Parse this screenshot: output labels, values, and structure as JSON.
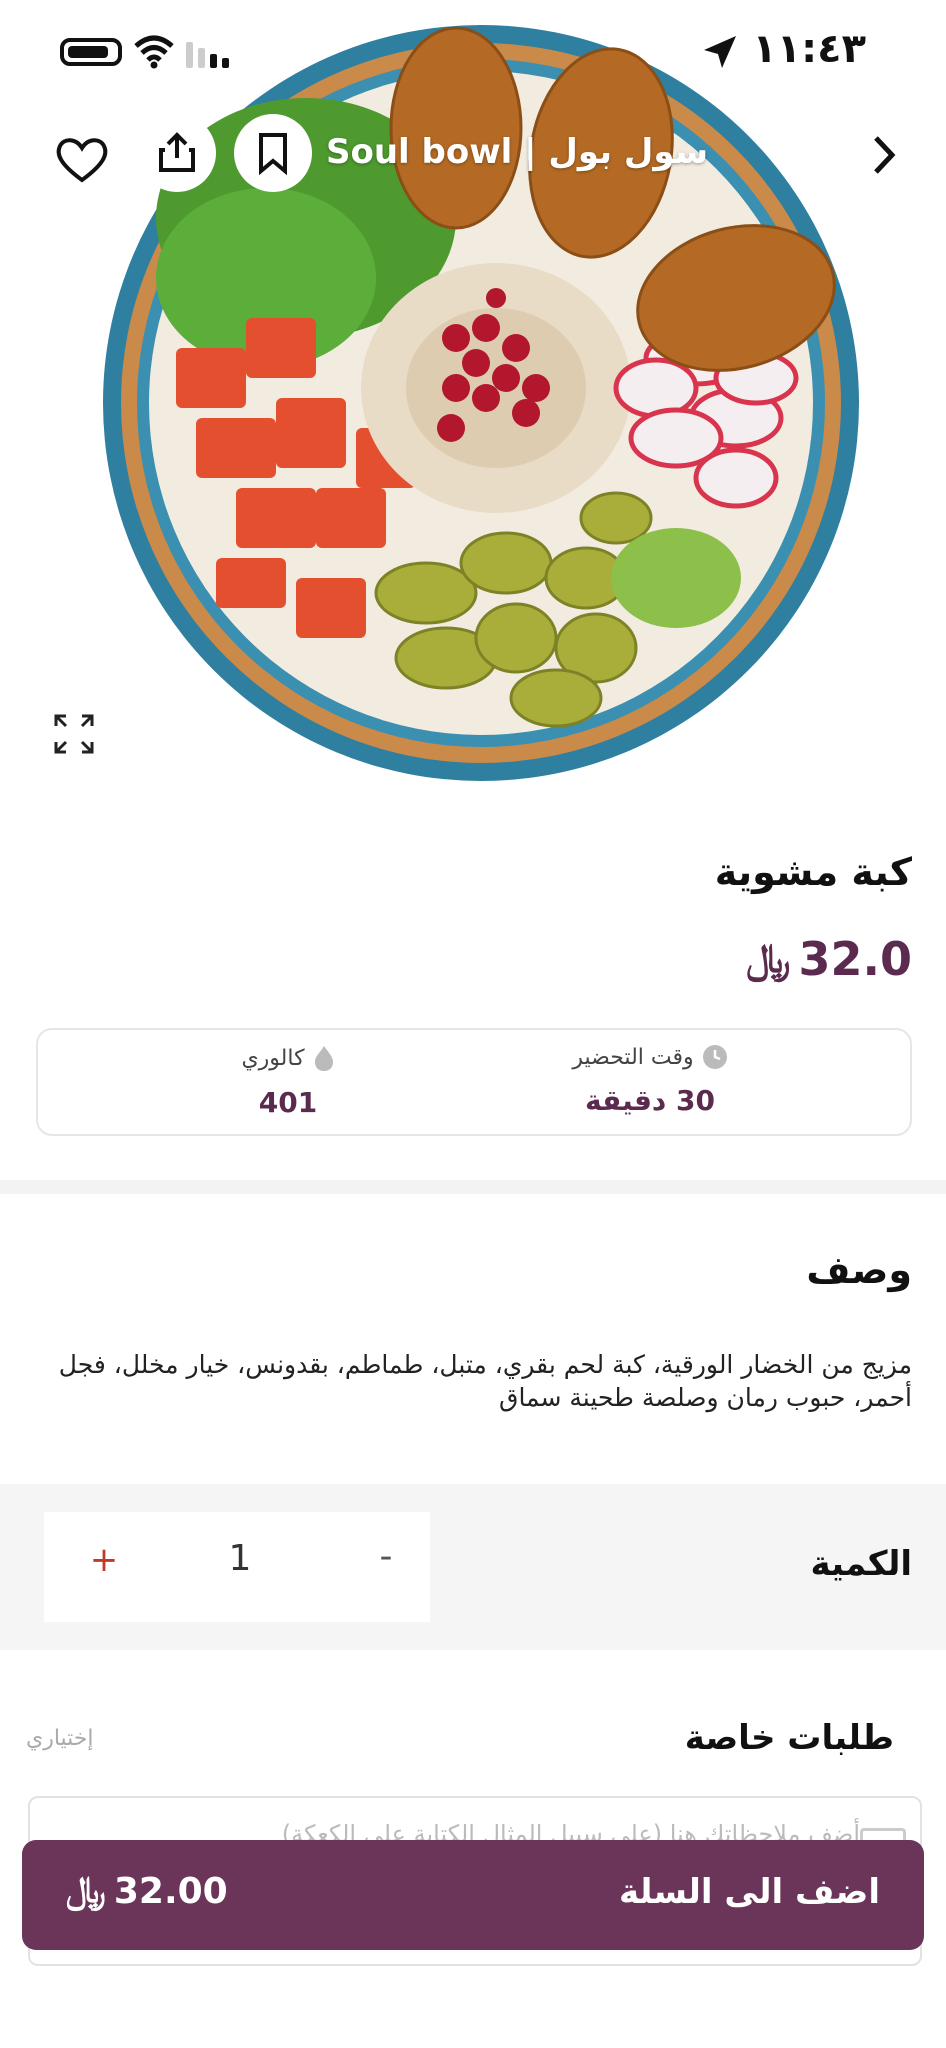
{
  "status_bar": {
    "time": "١١:٤٣"
  },
  "header": {
    "restaurant_name": "Soul bowl | سول بول"
  },
  "product": {
    "title": "كبة مشوية",
    "price": "32.0",
    "currency_symbol": "﷼"
  },
  "info": {
    "prep_label": "وقت التحضير",
    "prep_value": "30 دقيقة",
    "calories_label": "كالوري",
    "calories_value": "401"
  },
  "description": {
    "heading": "وصف",
    "text": "مزيج من الخضار الورقية، كبة لحم بقري، متبل، طماطم، بقدونس، خيار مخلل، فجل أحمر، حبوب رمان وصلصة طحينة سماق"
  },
  "quantity": {
    "label": "الكمية",
    "value": "1",
    "plus": "+",
    "minus": "-"
  },
  "special_requests": {
    "heading": "طلبات خاصة",
    "optional": "إختياري",
    "placeholder": "أضف ملاحظاتك هنا (على سبيل المثال الكتابة على الكعكة)"
  },
  "cart": {
    "label": "اضف الى السلة",
    "total": "32.00"
  },
  "colors": {
    "brand": "#6a3559",
    "price": "#5b2b4f",
    "plus": "#c0392b"
  }
}
